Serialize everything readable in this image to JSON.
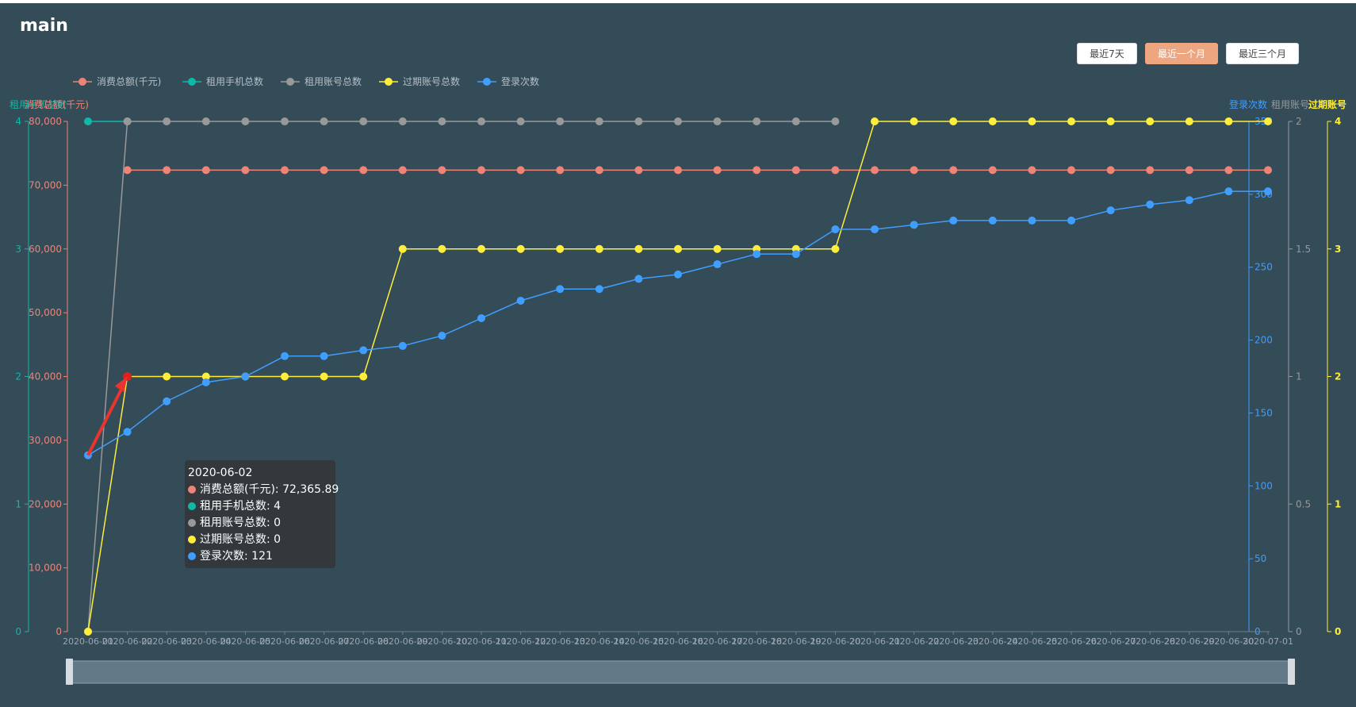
{
  "page": {
    "title": "main"
  },
  "range_buttons": [
    {
      "label": "最近7天",
      "active": false
    },
    {
      "label": "最近一个月",
      "active": true
    },
    {
      "label": "最近三个月",
      "active": false
    }
  ],
  "colors": {
    "background": "#344b58",
    "spend": "#ee8477",
    "phones": "#10b8a8",
    "accounts": "#999999",
    "expired": "#ffed3c",
    "logins": "#409eff",
    "active_button": "#eea681"
  },
  "chart_data": {
    "type": "line",
    "x": [
      "2020-06-01",
      "2020-06-02",
      "2020-06-03",
      "2020-06-04",
      "2020-06-05",
      "2020-06-06",
      "2020-06-07",
      "2020-06-08",
      "2020-06-09",
      "2020-06-10",
      "2020-06-11",
      "2020-06-12",
      "2020-06-13",
      "2020-06-14",
      "2020-06-15",
      "2020-06-16",
      "2020-06-17",
      "2020-06-18",
      "2020-06-19",
      "2020-06-20",
      "2020-06-21",
      "2020-06-22",
      "2020-06-23",
      "2020-06-24",
      "2020-06-25",
      "2020-06-26",
      "2020-06-27",
      "2020-06-28",
      "2020-06-29",
      "2020-06-30",
      "2020-07-01"
    ],
    "series": [
      {
        "name": "消费总额(千元)",
        "axis": "spend",
        "color": "#ee8477",
        "values": [
          null,
          72365.89,
          72365.89,
          72365.89,
          72365.89,
          72365.89,
          72365.89,
          72365.89,
          72365.89,
          72365.89,
          72365.89,
          72365.89,
          72365.89,
          72365.89,
          72365.89,
          72365.89,
          72365.89,
          72365.89,
          72365.89,
          72365.89,
          72365.89,
          72365.89,
          72365.89,
          72365.89,
          72365.89,
          72365.89,
          72365.89,
          72365.89,
          72365.89,
          72365.89,
          72365.89
        ]
      },
      {
        "name": "租用手机总数",
        "axis": "phones",
        "color": "#10b8a8",
        "values": [
          4,
          4,
          null,
          null,
          null,
          null,
          null,
          null,
          null,
          null,
          null,
          null,
          null,
          null,
          null,
          null,
          null,
          null,
          null,
          null,
          null,
          null,
          null,
          null,
          null,
          null,
          null,
          null,
          null,
          null,
          null
        ]
      },
      {
        "name": "租用账号总数",
        "axis": "accounts",
        "color": "#999999",
        "values": [
          0,
          2,
          2,
          2,
          2,
          2,
          2,
          2,
          2,
          2,
          2,
          2,
          2,
          2,
          2,
          2,
          2,
          2,
          2,
          2,
          null,
          null,
          null,
          null,
          null,
          null,
          null,
          null,
          null,
          null,
          null
        ]
      },
      {
        "name": "过期账号总数",
        "axis": "expired",
        "color": "#ffed3c",
        "values": [
          0,
          2,
          2,
          2,
          2,
          2,
          2,
          2,
          3,
          3,
          3,
          3,
          3,
          3,
          3,
          3,
          3,
          3,
          3,
          3,
          4,
          4,
          4,
          4,
          4,
          4,
          4,
          4,
          4,
          4,
          4
        ]
      },
      {
        "name": "登录次数",
        "axis": "logins",
        "color": "#409eff",
        "values": [
          121,
          137,
          158,
          171,
          175,
          189,
          189,
          193,
          196,
          203,
          215,
          227,
          235,
          235,
          242,
          245,
          252,
          259,
          259,
          276,
          276,
          279,
          282,
          282,
          282,
          282,
          289,
          293,
          296,
          302,
          302
        ]
      }
    ],
    "axes": [
      {
        "id": "phones",
        "name": "租用手机总数",
        "min": 0,
        "max": 4,
        "ticks": [
          "0",
          "1",
          "2",
          "3",
          "4"
        ],
        "color": "#10b8a8"
      },
      {
        "id": "spend",
        "name": "消费总额(千元)",
        "min": 0,
        "max": 80000,
        "ticks": [
          "0",
          "10,000",
          "20,000",
          "30,000",
          "40,000",
          "50,000",
          "60,000",
          "70,000",
          "80,000"
        ],
        "color": "#ee8477"
      },
      {
        "id": "logins",
        "name": "登录次数",
        "min": 0,
        "max": 350,
        "ticks": [
          "0",
          "50",
          "100",
          "150",
          "200",
          "250",
          "300",
          "350"
        ],
        "color": "#409eff"
      },
      {
        "id": "accounts",
        "name": "租用账号",
        "min": 0,
        "max": 2,
        "ticks": [
          "0",
          "0.5",
          "1",
          "1.5",
          "2"
        ],
        "color": "#999999"
      },
      {
        "id": "expired",
        "name": "过期账号",
        "min": 0,
        "max": 4,
        "ticks": [
          "0",
          "1",
          "2",
          "3",
          "4"
        ],
        "color": "#ffed3c"
      }
    ],
    "legend_position": "top-left",
    "grid": false,
    "data_zoom": "slider-full-range",
    "tooltip": {
      "title": "2020-06-02",
      "rows": [
        {
          "label": "消费总额(千元): 72,365.89",
          "color": "#ee8477"
        },
        {
          "label": "租用手机总数: 4",
          "color": "#10b8a8"
        },
        {
          "label": "租用账号总数: 0",
          "color": "#999999"
        },
        {
          "label": "过期账号总数: 0",
          "color": "#ffed3c"
        },
        {
          "label": "登录次数: 121",
          "color": "#409eff"
        }
      ]
    }
  }
}
